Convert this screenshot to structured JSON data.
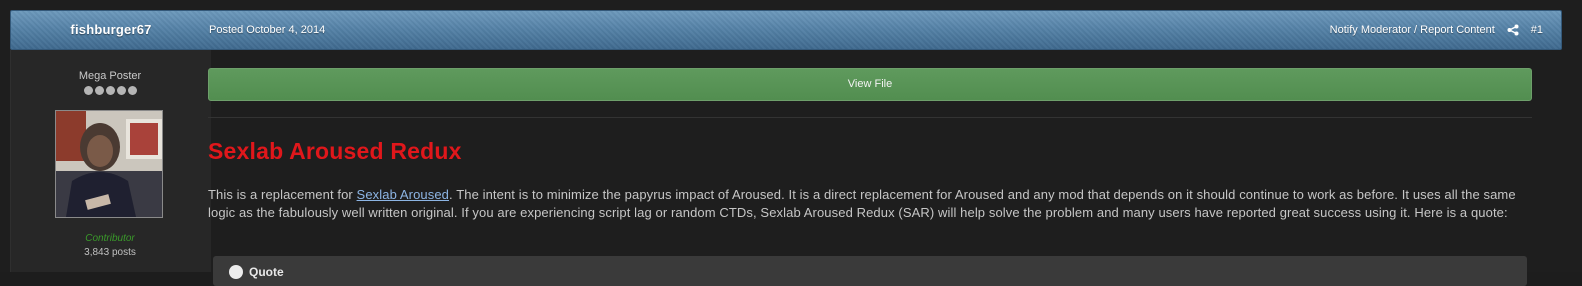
{
  "post": {
    "author": "fishburger67",
    "posted": "Posted October 4, 2014",
    "report_link": "Notify Moderator / Report Content",
    "post_number": "#1"
  },
  "sidebar": {
    "rank": "Mega Poster",
    "rank_pips": 5,
    "group": "Contributor",
    "post_count": "3,843 posts"
  },
  "content": {
    "view_file": "View File",
    "title": "Sexlab Aroused Redux",
    "intro": "This is a replacement for ",
    "link": "Sexlab Aroused",
    "body": ". The intent is to minimize the papyrus impact of Aroused. It is a direct replacement for Aroused and any mod that depends on it should continue to work as before. It uses all the same logic as the fabulously well written original. If you are experiencing script lag or random CTDs, Sexlab Aroused Redux (SAR) will help solve the problem and many users have reported great success using it. Here is a quote:",
    "quote_label": "Quote"
  },
  "colors": {
    "header": "#5683a8",
    "title": "#e0171b",
    "view_button": "#5a965a",
    "link": "#8db5e4",
    "group": "#3a9a2a"
  }
}
